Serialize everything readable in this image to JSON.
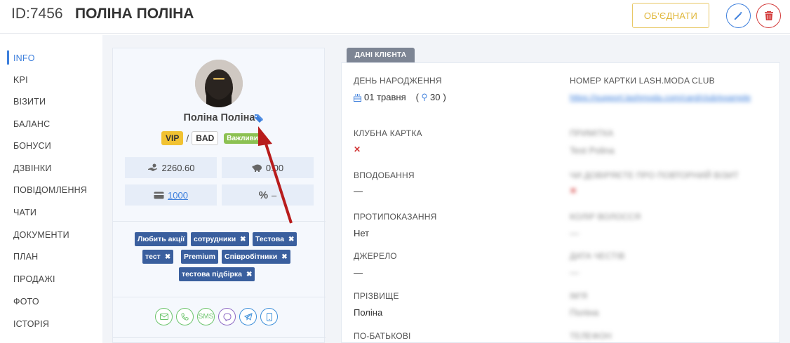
{
  "header": {
    "id_label": "ID:7456",
    "client_name": "ПОЛІНА ПОЛІНА",
    "merge_label": "ОБ'ЄДНАТИ"
  },
  "nav": {
    "items": [
      {
        "label": "INFO",
        "active": true
      },
      {
        "label": "KPI"
      },
      {
        "label": "ВІЗИТИ"
      },
      {
        "label": "БАЛАНС"
      },
      {
        "label": "БОНУСИ"
      },
      {
        "label": "ДЗВІНКИ"
      },
      {
        "label": "ПОВІДОМЛЕННЯ"
      },
      {
        "label": "ЧАТИ"
      },
      {
        "label": "ДОКУМЕНТИ"
      },
      {
        "label": "ПЛАН"
      },
      {
        "label": "ПРОДАЖІ"
      },
      {
        "label": "ФОТО"
      },
      {
        "label": "ІСТОРІЯ"
      }
    ]
  },
  "profile": {
    "name": "Поліна Поліна",
    "badges": {
      "vip": "VIP",
      "separator": "/",
      "bad": "BAD",
      "important": "Важливий"
    },
    "stats": {
      "balance": "2260.60",
      "savings": "0.00",
      "card": "1000",
      "discount_symbol": "%",
      "discount_value": "–"
    },
    "tags": [
      "Любить акції",
      "сотрудники",
      "Тестова",
      "тест",
      "Premium",
      "Співробітники",
      "тестова підбірка"
    ],
    "contacts": {
      "sms_label": "SMS"
    }
  },
  "client_data": {
    "tab_label": "ДАНІ КЛІЄНТА",
    "left_fields": [
      {
        "label": "ДЕНЬ НАРОДЖЕННЯ",
        "value": "01 травня",
        "extra": "30"
      },
      {
        "label": "КЛУБНА КАРТКА",
        "value": "✕"
      },
      {
        "label": "ВПОДОБАННЯ",
        "value": "—"
      },
      {
        "label": "ПРОТИПОКАЗАННЯ",
        "value": "Нет"
      },
      {
        "label": "ДЖЕРЕЛО",
        "value": "—"
      },
      {
        "label": "ПРІЗВИЩЕ",
        "value": "Поліна"
      },
      {
        "label": "ПО-БАТЬКОВІ",
        "value": ""
      }
    ],
    "right_fields": [
      {
        "label": "НОМЕР КАРТКИ LASH.MODA CLUB",
        "value": "https://support.lashmoda.com/card/club/example"
      },
      {
        "label": "ПРИМІТКА",
        "value": "Test Polina"
      },
      {
        "label": "ЧИ ДОВІРЯЄТЕ ПРО ПОВТОРНИЙ ВІЗИТ",
        "value": "✕"
      },
      {
        "label": "КОЛІР ВОЛОССЯ",
        "value": "—"
      },
      {
        "label": "ДАТА ЧЕСТІВ",
        "value": "—"
      },
      {
        "label": "ІМ'Я",
        "value": "Поліна"
      },
      {
        "label": "ТЕЛЕФОН",
        "value": ""
      }
    ]
  },
  "colors": {
    "accent": "#3d7fdc",
    "merge": "#e0b73a",
    "danger": "#d33b3b",
    "tag_chip": "#3a5f9e",
    "vip": "#f1c232",
    "important": "#8cc152",
    "arrow": "#b81c1c"
  }
}
